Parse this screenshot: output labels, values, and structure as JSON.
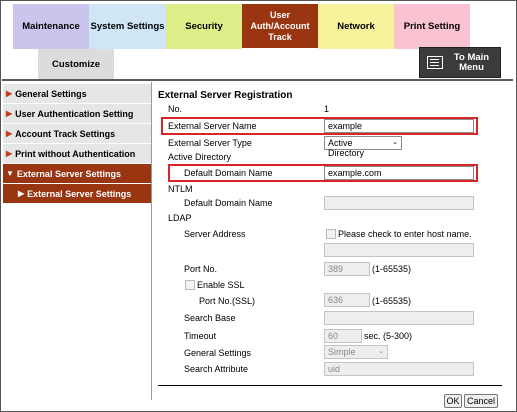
{
  "tabs": {
    "maintenance": "Maintenance",
    "system_settings": "System Settings",
    "security": "Security",
    "user_auth_line1": "User",
    "user_auth_line2": "Auth/Account",
    "user_auth_line3": "Track",
    "network": "Network",
    "print_setting": "Print Setting",
    "customize": "Customize"
  },
  "main_menu": {
    "line1": "To Main",
    "line2": "Menu",
    "icon": "menu-list-icon"
  },
  "sidebar": {
    "items": [
      {
        "label": "General Settings"
      },
      {
        "label": "User Authentication Setting"
      },
      {
        "label": "Account Track Settings"
      },
      {
        "label": "Print without Authentication"
      },
      {
        "label": "External Server Settings"
      },
      {
        "label": "External Server Settings"
      }
    ]
  },
  "form": {
    "title": "External Server Registration",
    "no_label": "No.",
    "no_value": "1",
    "server_name_label": "External Server Name",
    "server_name_value": "example",
    "server_type_label": "External Server Type",
    "server_type_value": "Active Directory",
    "active_directory_label": "Active Directory",
    "ad_domain_label": "Default Domain Name",
    "ad_domain_value": "example.com",
    "ntlm_label": "NTLM",
    "ntlm_domain_label": "Default Domain Name",
    "ntlm_domain_value": "",
    "ldap_label": "LDAP",
    "server_address_label": "Server Address",
    "host_name_check_label": "Please check to enter host name.",
    "server_address_value": "",
    "port_label": "Port No.",
    "port_value": "389",
    "port_range": "(1-65535)",
    "enable_ssl_label": "Enable SSL",
    "port_ssl_label": "Port No.(SSL)",
    "port_ssl_value": "636",
    "port_ssl_range": "(1-65535)",
    "search_base_label": "Search Base",
    "search_base_value": "",
    "timeout_label": "Timeout",
    "timeout_value": "60",
    "timeout_unit": "sec. (5-300)",
    "general_settings_label": "General Settings",
    "general_settings_value": "Simple",
    "search_attribute_label": "Search Attribute",
    "search_attribute_value": "uid"
  },
  "buttons": {
    "ok": "OK",
    "cancel": "Cancel"
  },
  "colors": {
    "active": "#9a3512",
    "highlight": "#d6262a"
  }
}
